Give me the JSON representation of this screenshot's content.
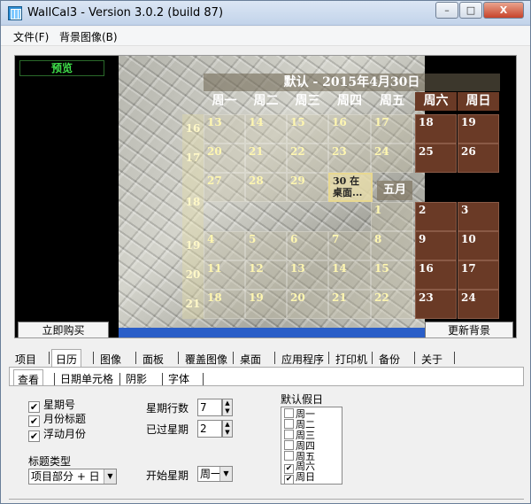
{
  "window": {
    "title": "WallCal3 - Version 3.0.2 (build 87)",
    "min": "–",
    "max": "□",
    "close": "X"
  },
  "menu": [
    "文件(F)",
    "背景图像(B)"
  ],
  "preview": {
    "label": "预览",
    "cal_title": "默认 - 2015年4月30日",
    "day_headers": [
      "周一",
      "周二",
      "周三",
      "周四",
      "周五",
      "周六",
      "周日"
    ],
    "weeks": [
      "16",
      "17",
      "18",
      "19",
      "20",
      "21"
    ],
    "row1": [
      "13",
      "14",
      "15",
      "16",
      "17",
      "18",
      "19"
    ],
    "row2": [
      "20",
      "21",
      "22",
      "23",
      "24",
      "25",
      "26"
    ],
    "row3": [
      "27",
      "28",
      "29",
      "30 在桌面...",
      "",
      "",
      ""
    ],
    "may_label": "五月",
    "row4": [
      "",
      "",
      "",
      "",
      "1",
      "2",
      "3"
    ],
    "row5": [
      "4",
      "5",
      "6",
      "7",
      "8",
      "9",
      "10"
    ],
    "row6": [
      "11",
      "12",
      "13",
      "14",
      "15",
      "16",
      "17"
    ],
    "row7": [
      "18",
      "19",
      "20",
      "21",
      "22",
      "23",
      "24"
    ],
    "buy_button": "立即购买",
    "update_button": "更新背景"
  },
  "tabs": [
    "项目",
    "日历",
    "图像",
    "面板",
    "覆盖图像",
    "桌面",
    "应用程序",
    "打印机",
    "备份",
    "关于"
  ],
  "subtabs": [
    "查看",
    "日期单元格",
    "阴影",
    "字体"
  ],
  "view": {
    "checkboxes": [
      {
        "label": "星期号",
        "checked": "✔"
      },
      {
        "label": "月份标题",
        "checked": "✔"
      },
      {
        "label": "浮动月份",
        "checked": "✔"
      }
    ],
    "title_type_label": "标题类型",
    "title_type_value": "项目部分 + 日",
    "weeks_rows_label": "星期行数",
    "weeks_rows_value": "7",
    "past_weeks_label": "已过星期",
    "past_weeks_value": "2",
    "start_week_label": "开始星期",
    "start_week_value": "周一",
    "holidays_label": "默认假日",
    "holidays": [
      {
        "label": "周一",
        "checked": ""
      },
      {
        "label": "周二",
        "checked": ""
      },
      {
        "label": "周三",
        "checked": ""
      },
      {
        "label": "周四",
        "checked": ""
      },
      {
        "label": "周五",
        "checked": ""
      },
      {
        "label": "周六",
        "checked": "✔"
      },
      {
        "label": "周日",
        "checked": "✔"
      }
    ]
  }
}
